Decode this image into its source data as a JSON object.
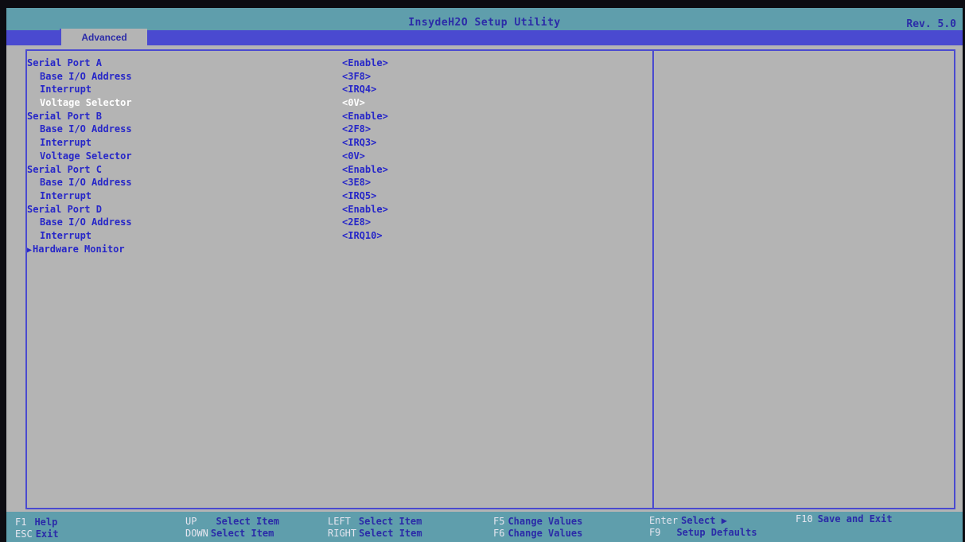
{
  "header": {
    "title": "InsydeH2O Setup Utility",
    "revision": "Rev. 5.0",
    "active_tab": "Advanced"
  },
  "settings": [
    {
      "label": "Serial Port A",
      "value": "<Enable>",
      "level": 0
    },
    {
      "label": "Base I/O Address",
      "value": "<3F8>",
      "level": 1
    },
    {
      "label": "Interrupt",
      "value": "<IRQ4>",
      "level": 1
    },
    {
      "label": "Voltage Selector",
      "value": "<0V>",
      "level": 1,
      "selected": true
    },
    {
      "label": "Serial Port B",
      "value": "<Enable>",
      "level": 0
    },
    {
      "label": "Base I/O Address",
      "value": "<2F8>",
      "level": 1
    },
    {
      "label": "Interrupt",
      "value": "<IRQ3>",
      "level": 1
    },
    {
      "label": "Voltage Selector",
      "value": "<0V>",
      "level": 1
    },
    {
      "label": "Serial Port C",
      "value": "<Enable>",
      "level": 0
    },
    {
      "label": "Base I/O Address",
      "value": "<3E8>",
      "level": 1
    },
    {
      "label": "Interrupt",
      "value": "<IRQ5>",
      "level": 1
    },
    {
      "label": "Serial Port D",
      "value": "<Enable>",
      "level": 0
    },
    {
      "label": "Base I/O Address",
      "value": "<2E8>",
      "level": 1
    },
    {
      "label": "Interrupt",
      "value": "<IRQ10>",
      "level": 1
    },
    {
      "label": "Hardware Monitor",
      "value": "",
      "level": 0,
      "submenu": true
    }
  ],
  "footer": {
    "f1": {
      "key": "F1",
      "desc": "Help"
    },
    "esc": {
      "key": "ESC",
      "desc": "Exit"
    },
    "up": {
      "key": "UP",
      "desc": "Select Item"
    },
    "down": {
      "key": "DOWN",
      "desc": "Select Item"
    },
    "left": {
      "key": "LEFT",
      "desc": "Select Item"
    },
    "right": {
      "key": "RIGHT",
      "desc": "Select Item"
    },
    "f5": {
      "key": "F5",
      "desc": "Change Values"
    },
    "f6": {
      "key": "F6",
      "desc": "Change Values"
    },
    "enter": {
      "key": "Enter",
      "desc": "Select ▶"
    },
    "f9": {
      "key": "F9",
      "desc": "Setup Defaults"
    },
    "f10": {
      "key": "F10",
      "desc": "Save and Exit"
    }
  },
  "colors": {
    "background": "#b4b4b4",
    "bar": "#5f9eac",
    "accent": "#4a4ad0",
    "text": "#2727c8",
    "selected_text": "#ffffff"
  }
}
